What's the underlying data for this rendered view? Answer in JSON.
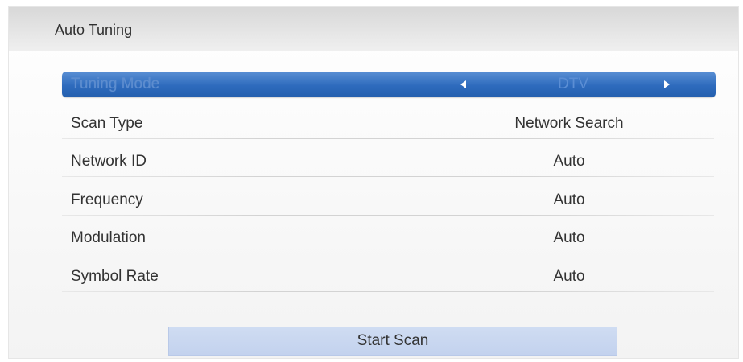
{
  "header": {
    "title": "Auto Tuning"
  },
  "settings": {
    "tuning_mode": {
      "label": "Tuning Mode",
      "value": "DTV"
    },
    "scan_type": {
      "label": "Scan Type",
      "value": "Network Search"
    },
    "network_id": {
      "label": "Network ID",
      "value": "Auto"
    },
    "frequency": {
      "label": "Frequency",
      "value": "Auto"
    },
    "modulation": {
      "label": "Modulation",
      "value": "Auto"
    },
    "symbol_rate": {
      "label": "Symbol Rate",
      "value": "Auto"
    }
  },
  "actions": {
    "start_scan": "Start Scan"
  },
  "colors": {
    "selection": "#2e6bbd",
    "button": "#c3d2ee",
    "header": "#e0e0e0"
  }
}
